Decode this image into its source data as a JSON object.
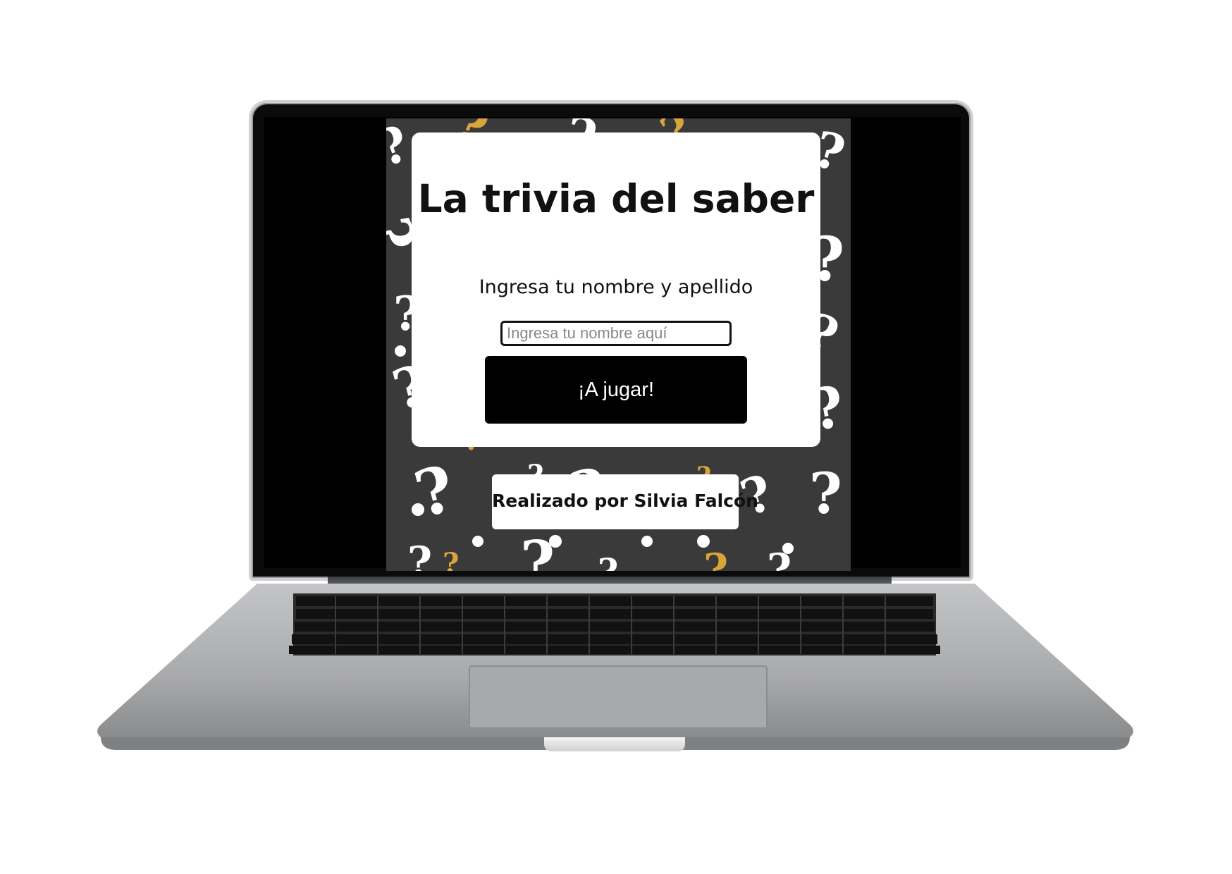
{
  "app": {
    "title": "La trivia del saber",
    "prompt": "Ingresa tu nombre y apellido",
    "name_input": {
      "placeholder": "Ingresa tu nombre aquí",
      "value": ""
    },
    "play_button_label": "¡A jugar!",
    "credit": "Realizado por Silvia Falcón"
  },
  "colors": {
    "background": "#3a3a3a",
    "accent_gold": "#d9a53a",
    "card": "#ffffff",
    "button": "#000000"
  },
  "icons": [
    "question-mark-pattern"
  ]
}
